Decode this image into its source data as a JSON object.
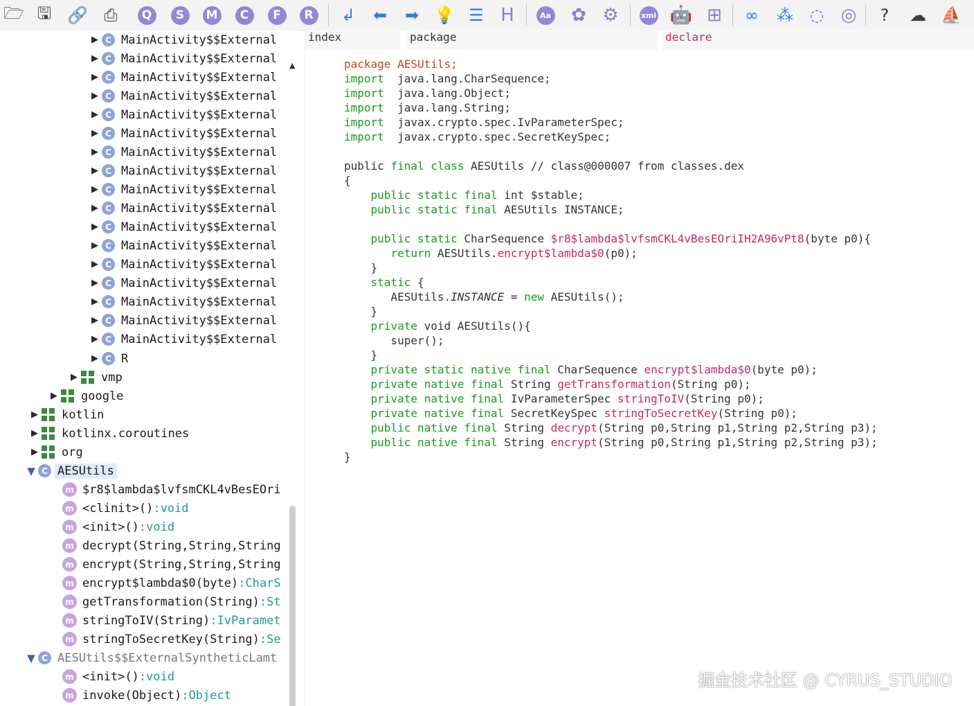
{
  "toolbar": {
    "buttons": [
      {
        "icon": "open-folder-icon"
      },
      {
        "icon": "save-icon"
      },
      {
        "icon": "link-icon"
      },
      {
        "icon": "export-icon"
      },
      {
        "icon": "q-icon",
        "text": "Q"
      },
      {
        "icon": "s-icon",
        "text": "S"
      },
      {
        "icon": "m-icon",
        "text": "M"
      },
      {
        "icon": "c-icon",
        "text": "C"
      },
      {
        "icon": "f-icon",
        "text": "F"
      },
      {
        "icon": "r-icon",
        "text": "R"
      },
      {
        "icon": "return-arrow-icon"
      },
      {
        "icon": "back-arrow-icon"
      },
      {
        "icon": "forward-arrow-icon"
      },
      {
        "icon": "bulb-icon"
      },
      {
        "icon": "text-list-icon"
      },
      {
        "icon": "h-icon",
        "text": "H"
      },
      {
        "icon": "aa-icon",
        "text": "Aa"
      },
      {
        "icon": "palette-icon"
      },
      {
        "icon": "settings-icon"
      },
      {
        "icon": "xml-icon",
        "text": "xml"
      },
      {
        "icon": "android-icon"
      },
      {
        "icon": "windows-icon"
      },
      {
        "icon": "infinity-icon"
      },
      {
        "icon": "graph-icon"
      },
      {
        "icon": "ring-icon"
      },
      {
        "icon": "fingerprint-icon"
      },
      {
        "icon": "help-icon",
        "text": "?"
      },
      {
        "icon": "cloud-icon"
      },
      {
        "icon": "boat-icon"
      }
    ]
  },
  "tree": {
    "items": [
      {
        "label": "MainActivity$$External",
        "kind": "class",
        "indent": 127
      },
      {
        "label": "MainActivity$$External",
        "kind": "class",
        "indent": 127
      },
      {
        "label": "MainActivity$$External",
        "kind": "class",
        "indent": 127
      },
      {
        "label": "MainActivity$$External",
        "kind": "class",
        "indent": 127
      },
      {
        "label": "MainActivity$$External",
        "kind": "class",
        "indent": 127
      },
      {
        "label": "MainActivity$$External",
        "kind": "class",
        "indent": 127
      },
      {
        "label": "MainActivity$$External",
        "kind": "class",
        "indent": 127
      },
      {
        "label": "MainActivity$$External",
        "kind": "class",
        "indent": 127
      },
      {
        "label": "MainActivity$$External",
        "kind": "class",
        "indent": 127
      },
      {
        "label": "MainActivity$$External",
        "kind": "class",
        "indent": 127
      },
      {
        "label": "MainActivity$$External",
        "kind": "class",
        "indent": 127
      },
      {
        "label": "MainActivity$$External",
        "kind": "class",
        "indent": 127
      },
      {
        "label": "MainActivity$$External",
        "kind": "class",
        "indent": 127
      },
      {
        "label": "MainActivity$$External",
        "kind": "class",
        "indent": 127
      },
      {
        "label": "MainActivity$$External",
        "kind": "class",
        "indent": 127
      },
      {
        "label": "MainActivity$$External",
        "kind": "class",
        "indent": 127
      },
      {
        "label": "MainActivity$$External",
        "kind": "class",
        "indent": 127
      },
      {
        "label": "R",
        "kind": "class",
        "indent": 127
      },
      {
        "label": "vmp",
        "kind": "package",
        "indent": 97
      },
      {
        "label": "google",
        "kind": "package",
        "indent": 68
      },
      {
        "label": "kotlin",
        "kind": "package",
        "indent": 40
      },
      {
        "label": "kotlinx.coroutines",
        "kind": "package",
        "indent": 40
      },
      {
        "label": "org",
        "kind": "package",
        "indent": 40
      },
      {
        "label": "AESUtils",
        "kind": "class-open",
        "indent": 35,
        "selected": true
      },
      {
        "label": "$r8$lambda$lvfsmCKL4vBesEOri",
        "kind": "method",
        "indent": 90
      },
      {
        "label": "<clinit>()",
        "ret": ":void",
        "kind": "method",
        "indent": 90
      },
      {
        "label": "<init>()",
        "ret": ":void",
        "kind": "method",
        "indent": 90
      },
      {
        "label": "decrypt(String,String,String",
        "kind": "method",
        "indent": 90
      },
      {
        "label": "encrypt(String,String,String",
        "kind": "method",
        "indent": 90
      },
      {
        "label": "encrypt$lambda$0(byte)",
        "ret": ":CharS",
        "kind": "method",
        "indent": 90
      },
      {
        "label": "getTransformation(String)",
        "ret": ":St",
        "kind": "method",
        "indent": 90
      },
      {
        "label": "stringToIV(String)",
        "ret": ":IvParamet",
        "kind": "method",
        "indent": 90
      },
      {
        "label": "stringToSecretKey(String)",
        "ret": ":Se",
        "kind": "method",
        "indent": 90
      },
      {
        "label": "AESUtils$$ExternalSyntheticLamt",
        "kind": "class-open-synth",
        "indent": 35
      },
      {
        "label": "<init>()",
        "ret": ":void",
        "kind": "method",
        "indent": 90
      },
      {
        "label": "invoke(Object)",
        "ret": ":Object",
        "kind": "method",
        "indent": 90
      }
    ]
  },
  "columns": {
    "index": "index",
    "package": "package",
    "declare": "declare"
  },
  "code": {
    "lines": [
      [
        [
          "pk",
          "package AESUtils;"
        ]
      ],
      [
        [
          "kw",
          "import"
        ],
        [
          "",
          "  java.lang.CharSequence;"
        ]
      ],
      [
        [
          "kw",
          "import"
        ],
        [
          "",
          "  java.lang.Object;"
        ]
      ],
      [
        [
          "kw",
          "import"
        ],
        [
          "",
          "  java.lang.String;"
        ]
      ],
      [
        [
          "kw",
          "import"
        ],
        [
          "",
          "  javax.crypto.spec.IvParameterSpec;"
        ]
      ],
      [
        [
          "kw",
          "import"
        ],
        [
          "",
          "  javax.crypto.spec.SecretKeySpec;"
        ]
      ],
      [],
      [
        [
          "",
          "public "
        ],
        [
          "kw",
          "final class"
        ],
        [
          "",
          " AESUtils // class@000007 from classes.dex"
        ]
      ],
      [
        [
          "",
          "{"
        ]
      ],
      [
        [
          "",
          "    "
        ],
        [
          "kw",
          "public static final"
        ],
        [
          "",
          " int $stable;"
        ]
      ],
      [
        [
          "",
          "    "
        ],
        [
          "kw",
          "public static final"
        ],
        [
          "",
          " AESUtils INSTANCE;"
        ]
      ],
      [],
      [
        [
          "",
          "    "
        ],
        [
          "kw",
          "public static"
        ],
        [
          "",
          " CharSequence "
        ],
        [
          "fn",
          "$r8$lambda$lvfsmCKL4vBesEOriIH2A96vPt8"
        ],
        [
          "",
          "(byte p0){"
        ]
      ],
      [
        [
          "",
          "       "
        ],
        [
          "kw",
          "return"
        ],
        [
          "",
          " AESUtils."
        ],
        [
          "fn",
          "encrypt$lambda$0"
        ],
        [
          "",
          "(p0);"
        ]
      ],
      [
        [
          "",
          "    }"
        ]
      ],
      [
        [
          "",
          "    "
        ],
        [
          "kw",
          "static"
        ],
        [
          "",
          " {"
        ]
      ],
      [
        [
          "",
          "       AESUtils."
        ],
        [
          "it",
          "INSTANCE"
        ],
        [
          "",
          " = "
        ],
        [
          "kw",
          "new"
        ],
        [
          "",
          " AESUtils();"
        ]
      ],
      [
        [
          "",
          "    }"
        ]
      ],
      [
        [
          "",
          "    "
        ],
        [
          "kw",
          "private"
        ],
        [
          "",
          " void AESUtils(){"
        ]
      ],
      [
        [
          "",
          "       super();"
        ]
      ],
      [
        [
          "",
          "    }"
        ]
      ],
      [
        [
          "",
          "    "
        ],
        [
          "kw",
          "private static native final"
        ],
        [
          "",
          " CharSequence "
        ],
        [
          "fn",
          "encrypt$lambda$0"
        ],
        [
          "",
          "(byte p0);"
        ]
      ],
      [
        [
          "",
          "    "
        ],
        [
          "kw",
          "private native final"
        ],
        [
          "",
          " String "
        ],
        [
          "fn",
          "getTransformation"
        ],
        [
          "",
          "(String p0);"
        ]
      ],
      [
        [
          "",
          "    "
        ],
        [
          "kw",
          "private native final"
        ],
        [
          "",
          " IvParameterSpec "
        ],
        [
          "fn",
          "stringToIV"
        ],
        [
          "",
          "(String p0);"
        ]
      ],
      [
        [
          "",
          "    "
        ],
        [
          "kw",
          "private native final"
        ],
        [
          "",
          " SecretKeySpec "
        ],
        [
          "fn",
          "stringToSecretKey"
        ],
        [
          "",
          "(String p0);"
        ]
      ],
      [
        [
          "",
          "    "
        ],
        [
          "kw",
          "public native final"
        ],
        [
          "",
          " String "
        ],
        [
          "fn",
          "decrypt"
        ],
        [
          "",
          "(String p0,String p1,String p2,String p3);"
        ]
      ],
      [
        [
          "",
          "    "
        ],
        [
          "kw",
          "public native final"
        ],
        [
          "",
          " String "
        ],
        [
          "fn",
          "encrypt"
        ],
        [
          "",
          "(String p0,String p1,String p2,String p3);"
        ]
      ],
      [
        [
          "",
          "}"
        ]
      ]
    ]
  },
  "watermark": "掘金技术社区 @ CYRUS_STUDIO"
}
